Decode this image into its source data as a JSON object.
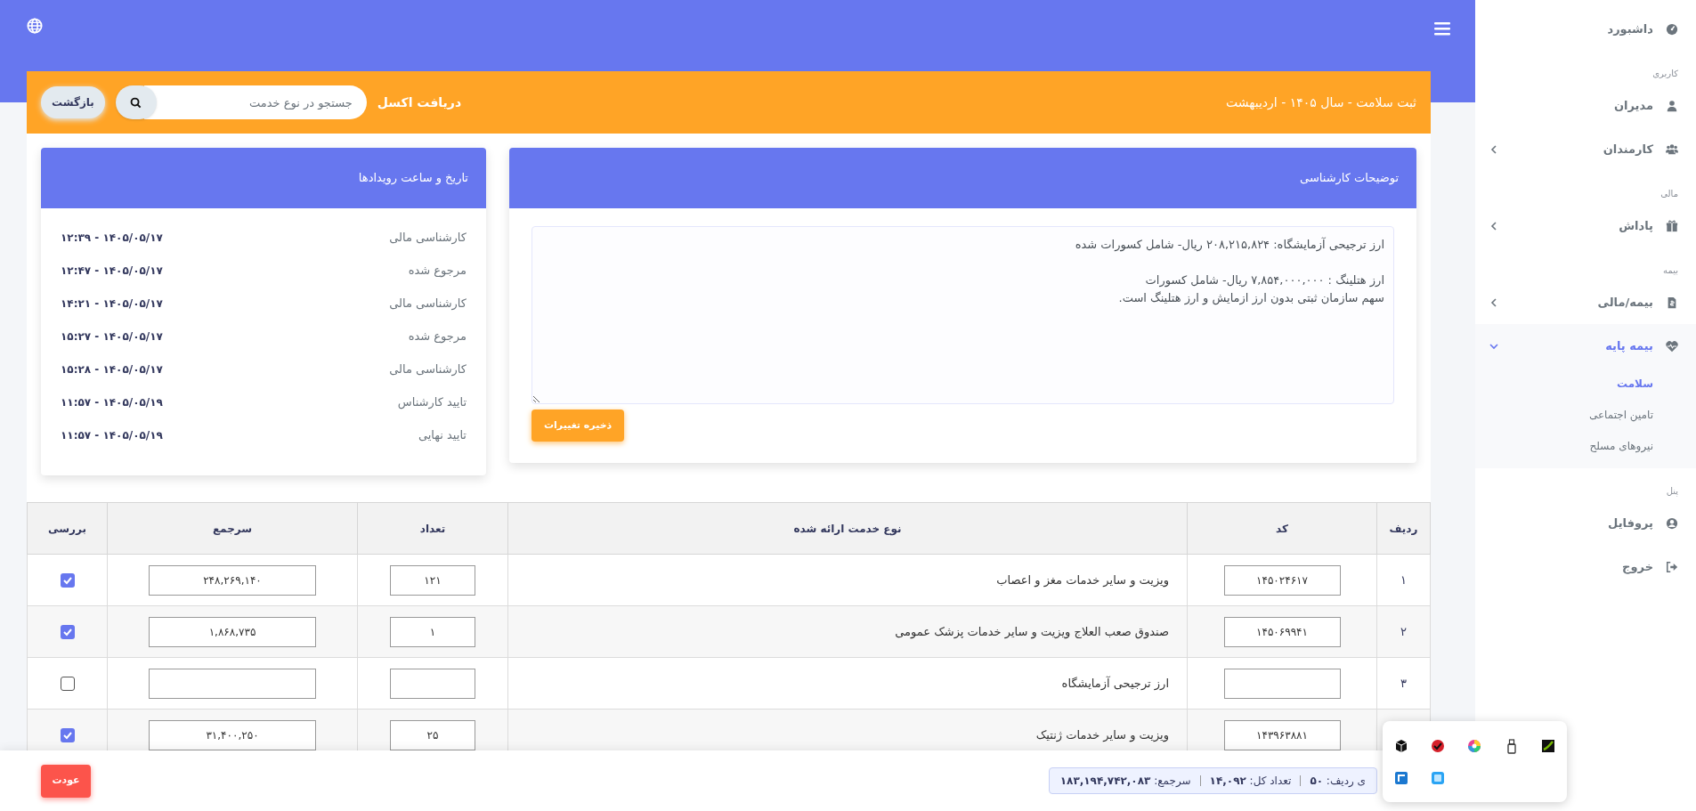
{
  "toolbar": {
    "title": "ثبت سلامت - سال ۱۴۰۵ - اردیبهشت",
    "excel_link": "دریافت اکسل",
    "search": {
      "placeholder": "جستجو در نوع خدمت"
    },
    "back_button": "بازگشت"
  },
  "notes_card": {
    "title": "توضیحات کارشناسی",
    "text": "ارز ترجیحی آزمایشگاه: ۲۰۸,۲۱۵,۸۲۴ ریال- شامل کسورات شده\n\nارز هتلینگ : ۷,۸۵۴,۰۰۰,۰۰۰ ریال- شامل کسورات\nسهم سازمان ثبتی بدون ارز ازمایش و ارز هتلینگ است.",
    "save_button": "ذخیره تغییرات"
  },
  "events_card": {
    "title": "تاریخ و ساعت رویدادها",
    "events": [
      {
        "label": "کارشناسی مالی",
        "time": "۱۴۰۵/۰۵/۱۷ - ۱۲:۳۹"
      },
      {
        "label": "مرجوع شده",
        "time": "۱۴۰۵/۰۵/۱۷ - ۱۲:۴۷"
      },
      {
        "label": "کارشناسی مالی",
        "time": "۱۴۰۵/۰۵/۱۷ - ۱۴:۲۱"
      },
      {
        "label": "مرجوع شده",
        "time": "۱۴۰۵/۰۵/۱۷ - ۱۵:۲۷"
      },
      {
        "label": "کارشناسی مالی",
        "time": "۱۴۰۵/۰۵/۱۷ - ۱۵:۲۸"
      },
      {
        "label": "تایید کارشناس",
        "time": "۱۴۰۵/۰۵/۱۹ - ۱۱:۵۷"
      },
      {
        "label": "تایید نهایی",
        "time": "۱۴۰۵/۰۵/۱۹ - ۱۱:۵۷"
      }
    ]
  },
  "table": {
    "columns": [
      "ردیف",
      "کد",
      "نوع خدمت ارائه شده",
      "تعداد",
      "سرجمع",
      "بررسی"
    ],
    "rows": [
      {
        "index": "۱",
        "code": "۱۴۵۰۲۴۶۱۷",
        "service": "ویزیت و سایر خدمات مغز و اعصاب",
        "count": "۱۲۱",
        "total": "۲۴۸,۲۶۹,۱۴۰",
        "checked": true
      },
      {
        "index": "۲",
        "code": "۱۴۵۰۶۹۹۴۱",
        "service": "صندوق صعب العلاج ویزیت و سایر خدمات پزشک عمومی",
        "count": "۱",
        "total": "۱,۸۶۸,۷۳۵",
        "checked": true
      },
      {
        "index": "۳",
        "service": "ارز ترجیحی آزمایشگاه",
        "checked": false
      },
      {
        "code": "۱۴۳۹۶۳۸۸۱",
        "service": "ویزیت و سایر خدمات ژنتیک",
        "count": "۲۵",
        "total": "۳۱,۴۰۰,۲۵۰",
        "checked": true
      }
    ]
  },
  "footer": {
    "summary": [
      {
        "label": "ی ردیف:",
        "value": "۵۰"
      },
      {
        "label": "تعداد کل:",
        "value": "۱۴,۰۹۲"
      },
      {
        "label": "سرجمع:",
        "value": "۱۸۳,۱۹۴,۷۴۲,۰۸۳"
      }
    ],
    "return_button": "عودت"
  },
  "sidebar": {
    "items": [
      {
        "kind": "link",
        "label": "داشبورد",
        "selected": false
      },
      {
        "kind": "heading",
        "label": "کاربری"
      },
      {
        "kind": "link",
        "label": "مدیران",
        "selected": false
      },
      {
        "kind": "group",
        "label": "کارمندان",
        "selected": false,
        "expanded": false
      },
      {
        "kind": "heading",
        "label": "مالی"
      },
      {
        "kind": "group",
        "label": "پاداش",
        "selected": false,
        "expanded": false
      },
      {
        "kind": "heading",
        "label": "بیمه"
      },
      {
        "kind": "group",
        "label": "بیمه/مالی",
        "selected": false,
        "expanded": false
      },
      {
        "kind": "group",
        "label": "بیمه پایه",
        "selected": true,
        "expanded": true,
        "children": [
          {
            "label": "سلامت",
            "selected": true
          },
          {
            "label": "تامین اجتماعی",
            "selected": false
          },
          {
            "label": "نیروهای مسلح",
            "selected": false
          }
        ]
      },
      {
        "kind": "heading",
        "label": "پنل"
      },
      {
        "kind": "link",
        "label": "پروفایل",
        "selected": false
      },
      {
        "kind": "link",
        "label": "خروج",
        "selected": false
      }
    ]
  }
}
